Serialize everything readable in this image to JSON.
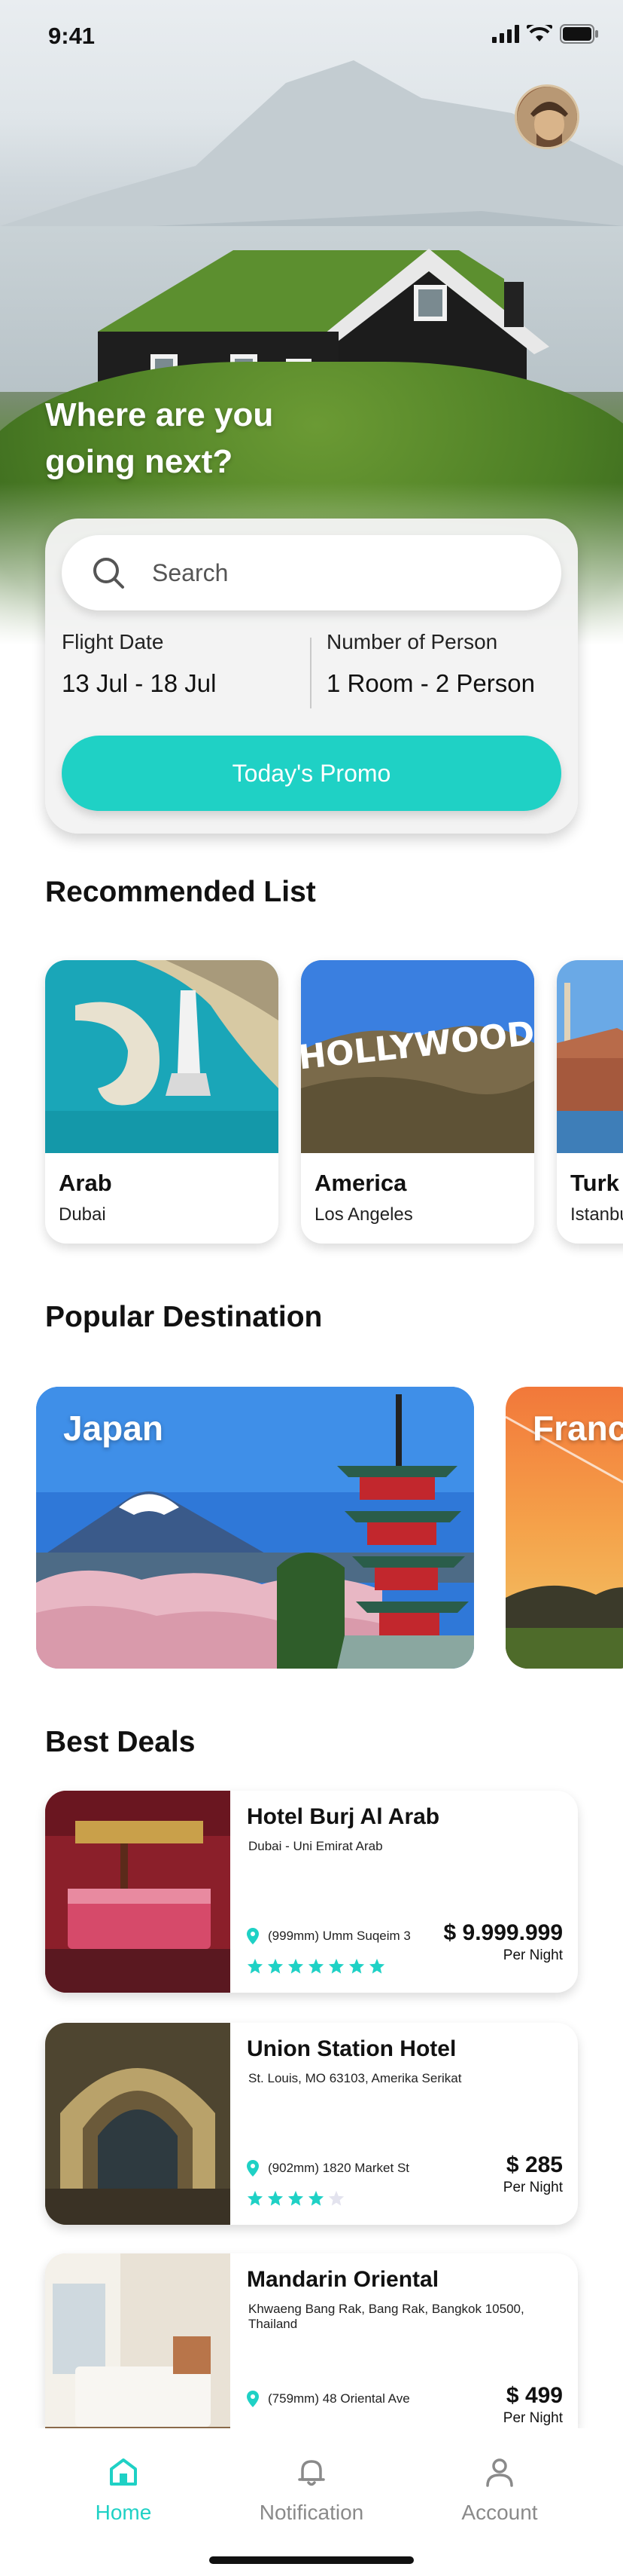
{
  "status_bar": {
    "time": "9:41"
  },
  "hero": {
    "title": "Where are you going next?"
  },
  "search": {
    "placeholder": "Search",
    "flight_date_label": "Flight Date",
    "flight_date_value": "13 Jul - 18 Jul",
    "persons_label": "Number of Person",
    "persons_value": "1 Room - 2 Person",
    "promo_button": "Today's Promo"
  },
  "recommended": {
    "title": "Recommended List",
    "items": [
      {
        "name": "Arab",
        "city": "Dubai"
      },
      {
        "name": "America",
        "city": "Los Angeles"
      },
      {
        "name": "Turk",
        "city": "Istanbu"
      }
    ]
  },
  "popular": {
    "title": "Popular Destination",
    "items": [
      {
        "name": "Japan"
      },
      {
        "name": "Franc"
      }
    ]
  },
  "deals": {
    "title": "Best Deals",
    "items": [
      {
        "name": "Hotel Burj Al Arab",
        "address": "Dubai - Uni Emirat Arab",
        "location": "(999mm) Umm Suqeim 3",
        "price": "$ 9.999.999",
        "per": "Per Night",
        "rating": 7,
        "rating_max": 7
      },
      {
        "name": "Union Station Hotel",
        "address": "St. Louis, MO 63103, Amerika Serikat",
        "location": "(902mm) 1820 Market St",
        "price": "$ 285",
        "per": "Per Night",
        "rating": 4,
        "rating_max": 5
      },
      {
        "name": "Mandarin Oriental",
        "address": "Khwaeng Bang Rak, Bang Rak, Bangkok 10500, Thailand",
        "location": "(759mm) 48 Oriental Ave",
        "price": "$ 499",
        "per": "Per Night",
        "rating": 0,
        "rating_max": 0
      }
    ]
  },
  "nav": {
    "items": [
      {
        "label": "Home",
        "icon": "home-icon",
        "active": true
      },
      {
        "label": "Notification",
        "icon": "bell-icon",
        "active": false
      },
      {
        "label": "Account",
        "icon": "user-icon",
        "active": false
      }
    ]
  },
  "colors": {
    "accent": "#1fd1c5",
    "star": "#1fd1c5",
    "star_empty": "#e3e3ee"
  }
}
